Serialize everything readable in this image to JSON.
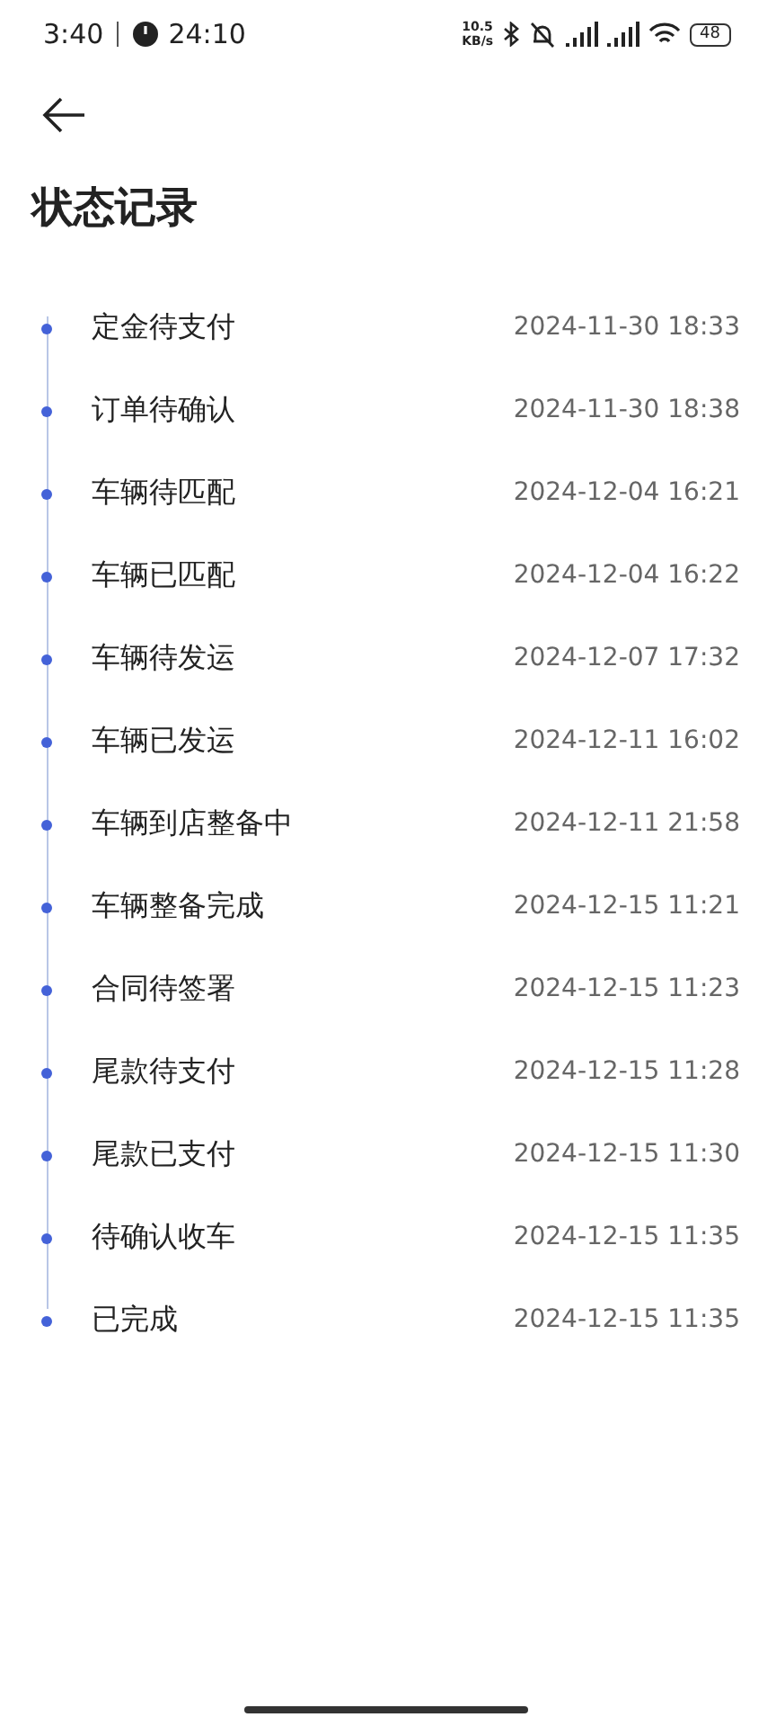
{
  "status_bar": {
    "time": "3:40",
    "timer": "24:10",
    "speed_value": "10.5",
    "speed_unit": "KB/s",
    "battery": "48"
  },
  "title": "状态记录",
  "timeline": [
    {
      "label": "定金待支付",
      "time": "2024-11-30 18:33"
    },
    {
      "label": "订单待确认",
      "time": "2024-11-30 18:38"
    },
    {
      "label": "车辆待匹配",
      "time": "2024-12-04 16:21"
    },
    {
      "label": "车辆已匹配",
      "time": "2024-12-04 16:22"
    },
    {
      "label": "车辆待发运",
      "time": "2024-12-07 17:32"
    },
    {
      "label": "车辆已发运",
      "time": "2024-12-11 16:02"
    },
    {
      "label": "车辆到店整备中",
      "time": "2024-12-11 21:58"
    },
    {
      "label": "车辆整备完成",
      "time": "2024-12-15 11:21"
    },
    {
      "label": "合同待签署",
      "time": "2024-12-15 11:23"
    },
    {
      "label": "尾款待支付",
      "time": "2024-12-15 11:28"
    },
    {
      "label": "尾款已支付",
      "time": "2024-12-15 11:30"
    },
    {
      "label": "待确认收车",
      "time": "2024-12-15 11:35"
    },
    {
      "label": "已完成",
      "time": "2024-12-15 11:35"
    }
  ]
}
